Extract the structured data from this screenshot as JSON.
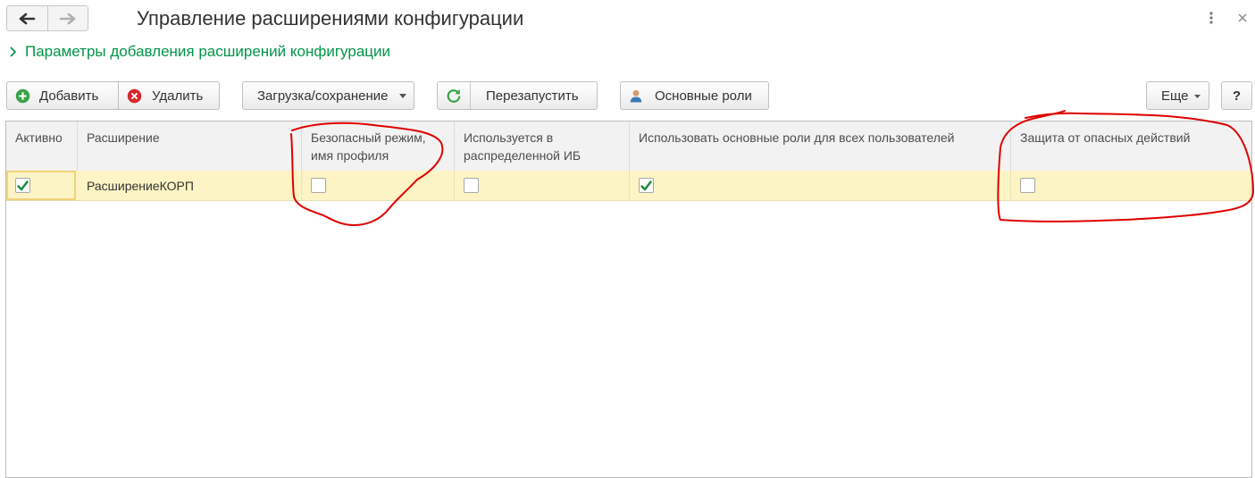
{
  "window": {
    "title": "Управление расширениями конфигурации"
  },
  "params_link": {
    "label": "Параметры добавления расширений конфигурации"
  },
  "toolbar": {
    "add_label": "Добавить",
    "delete_label": "Удалить",
    "load_save_label": "Загрузка/сохранение",
    "restart_label": "Перезапустить",
    "main_roles_label": "Основные роли",
    "more_label": "Еще",
    "help_label": "?"
  },
  "table": {
    "columns": [
      "Активно",
      "Расширение",
      "Безопасный режим, имя профиля",
      "Используется в распределенной ИБ",
      "Использовать основные роли для всех пользователей",
      "Защита от опасных действий"
    ],
    "rows": [
      {
        "active": true,
        "name": "РасширениеКОРП",
        "safe_mode": false,
        "distributed_ib": false,
        "main_roles_all_users": true,
        "danger_protection": false
      }
    ]
  },
  "colors": {
    "accent_green": "#009646",
    "selected_row": "#fcf4c4",
    "annotation_red": "#e00000",
    "delete_red": "#d9262b"
  },
  "icons": {
    "back": "arrow-left-icon",
    "forward": "arrow-right-icon",
    "menu": "kebab-menu-icon",
    "close": "close-icon",
    "add": "plus-circle-icon",
    "delete": "x-circle-icon",
    "restart": "refresh-icon",
    "roles": "user-icon"
  }
}
